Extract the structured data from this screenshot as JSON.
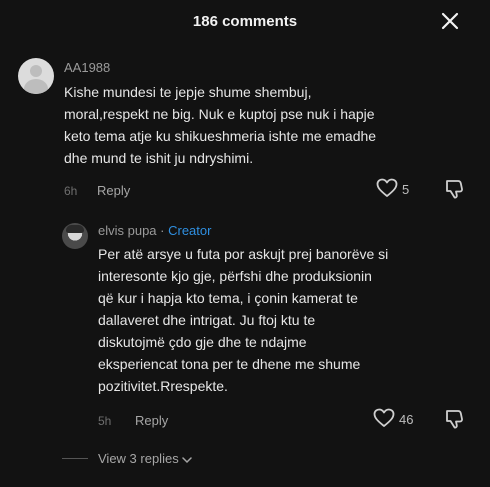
{
  "header": {
    "title": "186 comments"
  },
  "comment": {
    "username": "AA1988",
    "lines": [
      "Kishe mundesi te jepje shume shembuj,",
      "moral,respekt ne big. Nuk e kuptoj pse nuk i hapje",
      "keto tema atje ku shikueshmeria ishte me emadhe",
      "dhe mund te ishit ju ndryshimi."
    ],
    "time": "6h",
    "reply_label": "Reply",
    "likes": "5"
  },
  "reply": {
    "username": "elvis pupa",
    "separator": " · ",
    "creator_badge": "Creator",
    "lines": [
      "Per atë arsye u futa por askujt prej banorëve si",
      "interesonte kjo gje, përfshi dhe produksionin",
      "që kur i hapja kto tema, i çonin kamerat te",
      "dallaveret dhe intrigat. Ju ftoj ktu te",
      "diskutojmë çdo gje dhe te ndajme",
      "eksperiencat tona per te dhene me shume",
      "pozitivitet.Rrespekte."
    ],
    "time": "5h",
    "reply_label": "Reply",
    "likes": "46"
  },
  "view_replies": {
    "label": "View 3 replies"
  },
  "icons": [
    "close-icon",
    "heart-icon",
    "dislike-icon",
    "chevron-down-icon"
  ]
}
